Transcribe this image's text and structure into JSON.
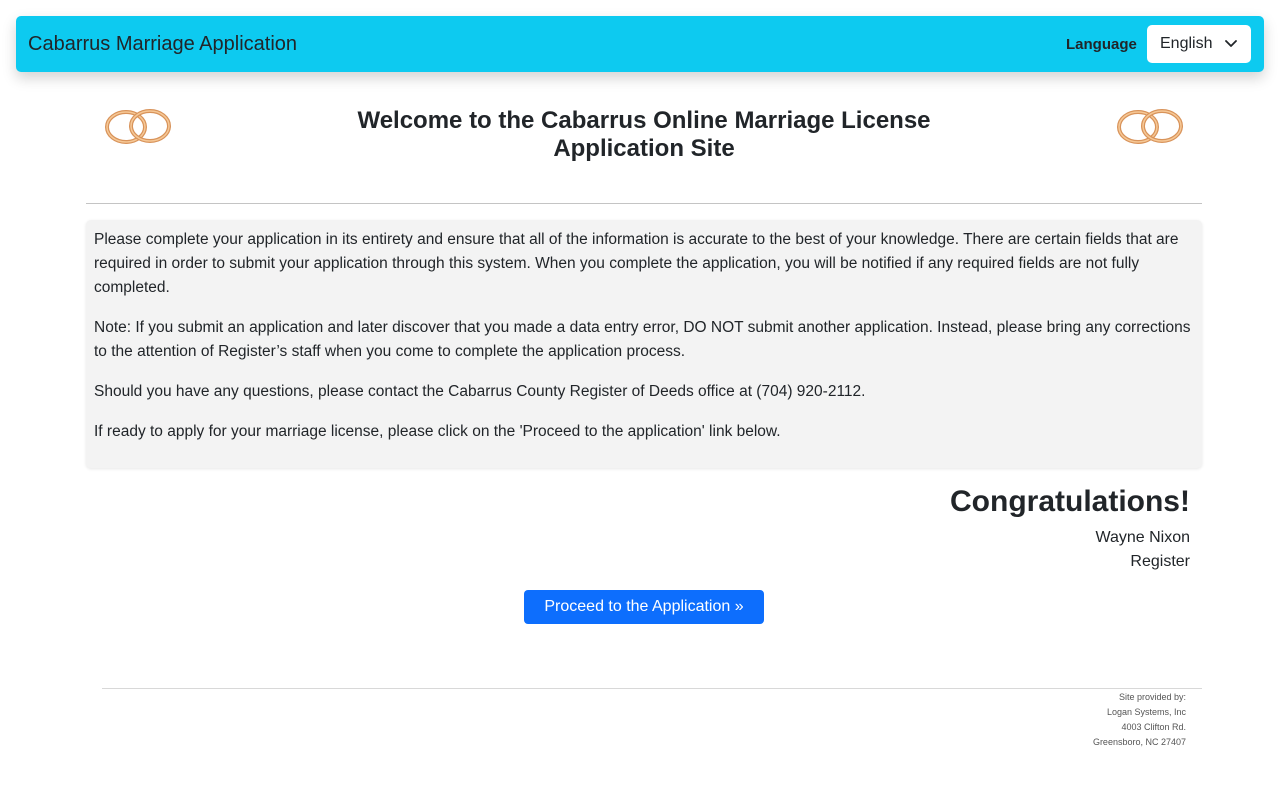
{
  "header": {
    "brand": "Cabarrus Marriage Application",
    "language_label": "Language",
    "language_selected": "English"
  },
  "welcome": {
    "title": "Welcome to the Cabarrus Online Marriage License Application Site"
  },
  "info": {
    "paragraphs": [
      "Please complete your application in its entirety and ensure that all of the information is accurate to the best of your knowledge. There are certain fields that are required in order to submit your application through this system. When you complete the application, you will be notified if any required fields are not fully completed.",
      "Note: If you submit an application and later discover that you made a data entry error, DO NOT submit another application. Instead, please bring any corrections to the attention of Register’s staff when you come to complete the application process.",
      "Should you have any questions, please contact the Cabarrus County Register of Deeds office at (704) 920-2112.",
      "If ready to apply for your marriage license, please click on the 'Proceed to the application' link below."
    ]
  },
  "signoff": {
    "heading": "Congratulations!",
    "name": "Wayne Nixon",
    "title": "Register"
  },
  "actions": {
    "proceed_label": "Proceed to the Application  »"
  },
  "footer": {
    "lines": [
      "Site provided by:",
      "Logan Systems, Inc",
      "4003 Clifton Rd.",
      "Greensboro, NC 27407"
    ]
  },
  "icons": {
    "rings_left": "wedding-rings-icon",
    "rings_right": "wedding-rings-icon",
    "dropdown": "chevron-down-icon"
  },
  "colors": {
    "navbar": "#0dcaf0",
    "button": "#0d6efd",
    "panel": "#f3f3f3",
    "ring_gold": "#e0a060"
  }
}
